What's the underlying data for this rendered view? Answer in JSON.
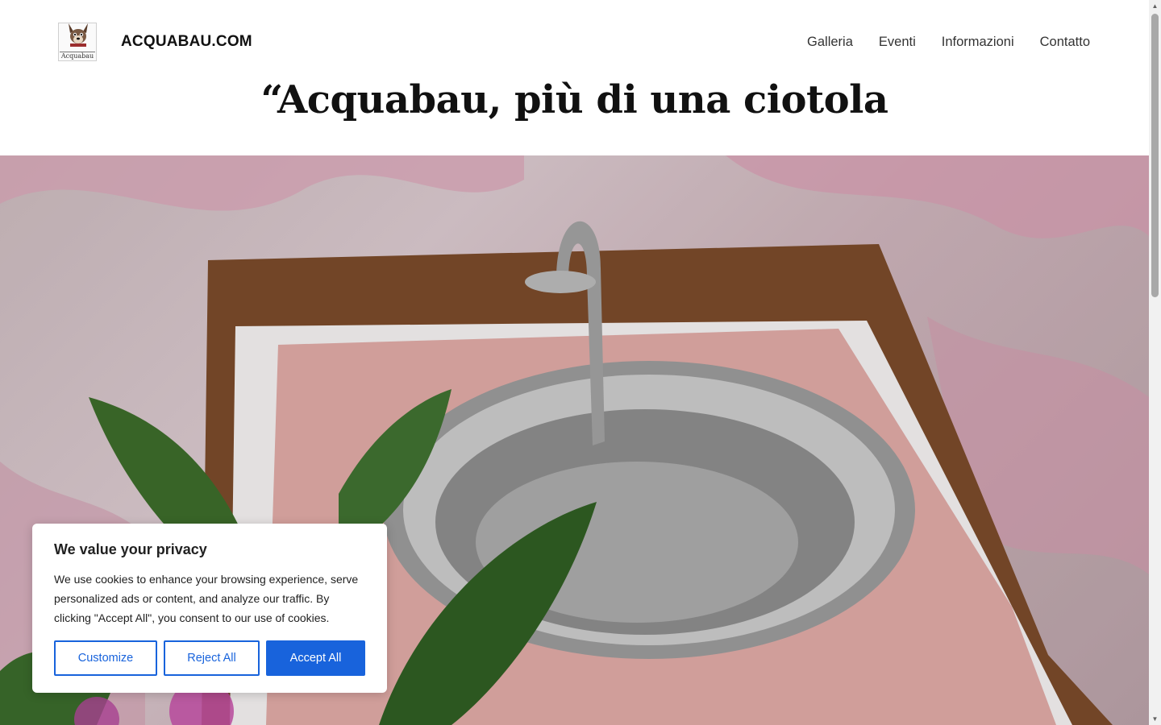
{
  "site": {
    "title": "ACQUABAU.COM",
    "logo_text": "Acquabau",
    "logo_icon": "dog-logo-icon"
  },
  "nav": {
    "items": [
      {
        "label": "Galleria"
      },
      {
        "label": "Eventi"
      },
      {
        "label": "Informazioni"
      },
      {
        "label": "Contatto"
      }
    ]
  },
  "hero": {
    "headline": "“Acquabau, più di una ciotola",
    "image": "photo of a stainless steel dog water bowl with faucet set in a wooden frame, with pink orchids and green leaves"
  },
  "cookie": {
    "title": "We value your privacy",
    "text": "We use cookies to enhance your browsing experience, serve personalized ads or content, and analyze our traffic. By clicking \"Accept All\", you consent to our use of cookies.",
    "customize_label": "Customize",
    "reject_label": "Reject All",
    "accept_label": "Accept All",
    "accent_color": "#1863dc"
  }
}
